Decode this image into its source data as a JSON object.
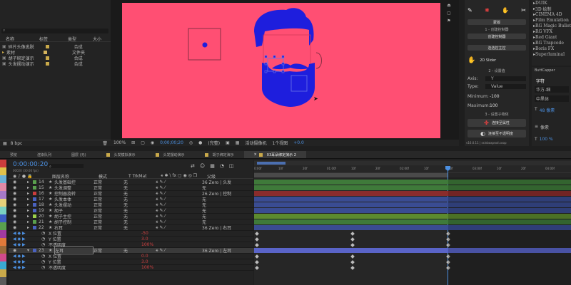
{
  "project": {
    "search_placeholder": "",
    "columns": [
      "名称",
      "标签",
      "类型",
      "大小"
    ],
    "items": [
      {
        "name": "碎片头像逃脱",
        "color": "#c9a94a",
        "type": "合成"
      },
      {
        "name": "素材",
        "color": "#d4b35c",
        "type": "文件夹"
      },
      {
        "name": "胡子绑定演示",
        "color": "#c9a94a",
        "type": "合成"
      },
      {
        "name": "头发摆动演示",
        "color": "#c9a94a",
        "type": "合成"
      }
    ],
    "bpc": "8 bpc"
  },
  "viewer": {
    "zoom": "100%",
    "timecode": "0;00;00;20",
    "quality": "(完整)",
    "camera": "活动摄像机",
    "views": "1个视图",
    "exposure": "+0.0",
    "bg_color": "#ff4f73"
  },
  "tools": {
    "title": "蒙版",
    "sec1": "1 - 创建控制器",
    "btn_select_parent": "创建控制器",
    "btn_selected": "选选控主控",
    "slider_label": "2D Slider",
    "sec2": "2 - 设置值",
    "axis_label": "Axis:",
    "axis_value": "Y",
    "type_label": "Type:",
    "type_value": "Value",
    "min_label": "Minimum:",
    "min_value": "-100",
    "max_label": "Maximum:",
    "max_value": "100",
    "sec3": "3 - 设置子物体",
    "btn_connect": "连接至属性",
    "btn_opacity": "连接至不透明度",
    "version": "v16.0.11 | rainboxprod.coop"
  },
  "effects_list": [
    "DUIK",
    "3D 绘制",
    "CINEMA 4D",
    "Film Emulation",
    "RG Magic Bullet",
    "RG VFX",
    "Red Giant",
    "RG Trapcode",
    "Boris FX",
    "Superluminal"
  ],
  "character": {
    "panel_label": "ButtCapper",
    "tab": "字符",
    "font_name": "华方-细",
    "font_style": "中黑体",
    "size": "48 像素",
    "tracking": "像素",
    "scale": "100 %"
  },
  "tabs": [
    "预览",
    "渲染队列",
    "图层 (无)",
    "头发模拟演示",
    "头发摆动演示",
    "胡子绑定演示",
    "03耳朵绑定演示 2"
  ],
  "active_tab": 6,
  "timeline": {
    "timecode": "0:00:00:20",
    "fps": "00020 (30.00 fps)",
    "headers": {
      "name": "图层名称",
      "mode": "模式",
      "trk": "T TrkMat",
      "parent": "父级"
    },
    "ruler": [
      "0:00f",
      "10f",
      "20f",
      "01:00f",
      "10f",
      "20f",
      "02:00f",
      "10f",
      "20f",
      "03:00f",
      "10f",
      "20f",
      "04:00f"
    ],
    "layers": [
      {
        "num": "14",
        "name": "头发基础控",
        "color": "#5aa04e",
        "mode": "正常",
        "parent": "36 Zero | 头发",
        "bar": "#3f7a3a"
      },
      {
        "num": "15",
        "name": "头发调整",
        "color": "#5aa04e",
        "mode": "正常",
        "parent": "无",
        "bar": "#3f7a3a"
      },
      {
        "num": "16",
        "name": "控制器旋转",
        "color": "#cc3d3d",
        "mode": "正常",
        "parent": "26 Zero | 控制",
        "bar": "#8a2c2c"
      },
      {
        "num": "17",
        "name": "头发本体",
        "color": "#4a62c0",
        "mode": "正常",
        "parent": "无",
        "bar": "#3a4c92"
      },
      {
        "num": "18",
        "name": "头发摆动",
        "color": "#4a62c0",
        "mode": "正常",
        "parent": "无",
        "bar": "#3a4c92"
      },
      {
        "num": "19",
        "name": "胡子",
        "color": "#4a62c0",
        "mode": "正常",
        "parent": "无",
        "bar": "#3a4c92"
      },
      {
        "num": "20",
        "name": "胡子主控",
        "color": "#9bd14a",
        "mode": "正常",
        "parent": "无",
        "bar": "#5c8a2e"
      },
      {
        "num": "21",
        "name": "胡子控制",
        "color": "#5aa04e",
        "mode": "正常",
        "parent": "无",
        "bar": "#3f7a3a"
      },
      {
        "num": "22",
        "name": "右耳",
        "color": "#4a62c0",
        "mode": "正常",
        "parent": "36 Zero | 右耳",
        "bar": "#3a4c92"
      }
    ],
    "props": [
      {
        "name": "X 位置",
        "value": "-50"
      },
      {
        "name": "Y 位置",
        "value": "3.0"
      },
      {
        "name": "不透明度",
        "value": "100%"
      }
    ],
    "selected_layer": {
      "num": "23",
      "name": "左耳",
      "mode": "正常",
      "parent": "36 Zero | 左耳"
    },
    "props2": [
      {
        "name": "X 位置",
        "value": "0.0"
      },
      {
        "name": "Y 位置",
        "value": "3.0"
      },
      {
        "name": "不透明度",
        "value": "100%"
      }
    ]
  },
  "label_colors": [
    "#cc3d3d",
    "#e0c14a",
    "#6bb1d6",
    "#e08aa6",
    "#a679c7",
    "#e6d17a",
    "#7ad1c2",
    "#3c5ec4",
    "#5aa04e",
    "#a13aa1",
    "#e07a3a",
    "#9b6b3a",
    "#d14a8a",
    "#3aaad1",
    "#c9a94a",
    "#5a5a5a"
  ]
}
